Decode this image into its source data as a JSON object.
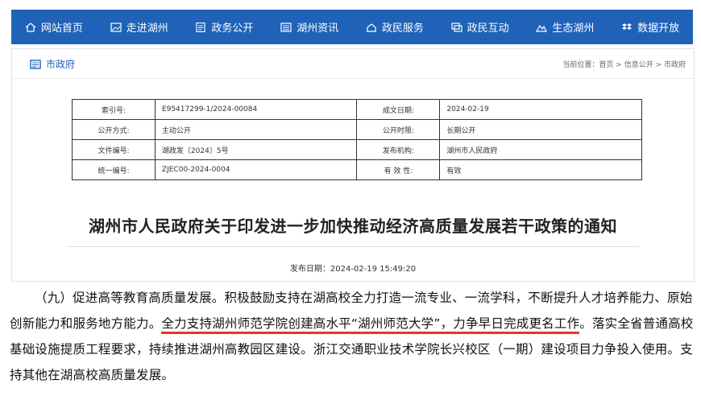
{
  "nav": [
    {
      "label": "网站首页",
      "icon": "home-icon"
    },
    {
      "label": "走进湖州",
      "icon": "picture-icon"
    },
    {
      "label": "政务公开",
      "icon": "document-icon"
    },
    {
      "label": "湖州资讯",
      "icon": "news-icon"
    },
    {
      "label": "政民服务",
      "icon": "service-icon"
    },
    {
      "label": "政民互动",
      "icon": "chat-icon"
    },
    {
      "label": "生态湖州",
      "icon": "mountain-icon"
    },
    {
      "label": "数据开放",
      "icon": "dropbox-icon"
    }
  ],
  "section": {
    "label": "市政府",
    "icon": "newspaper-icon"
  },
  "breadcrumb": {
    "prefix": "当前位置：",
    "items": [
      "首页",
      "信息公开",
      "市政府"
    ],
    "separator": " > "
  },
  "info": {
    "rows": [
      [
        {
          "k": "索引号:",
          "v": "E95417299-1/2024-00084"
        },
        {
          "k": "成文日期:",
          "v": "2024-02-19"
        }
      ],
      [
        {
          "k": "公开方式:",
          "v": "主动公开"
        },
        {
          "k": "公开时限:",
          "v": "长期公开"
        }
      ],
      [
        {
          "k": "文件编号:",
          "v": "湖政发〔2024〕5号"
        },
        {
          "k": "发布机构:",
          "v": "湖州市人民政府"
        }
      ],
      [
        {
          "k": "统一编号:",
          "v": "ZJEC00-2024-0004"
        },
        {
          "k": "有 效 性:",
          "v": "有效"
        }
      ]
    ]
  },
  "doc": {
    "title": "湖州市人民政府关于印发进一步加快推动经济高质量发展若干政策的通知",
    "pub_label": "发布日期：",
    "pub_date": "2024-02-19 15:49:20"
  },
  "article": {
    "p1": "（九）促进高等教育高质量发展。积极鼓励支持在湖高校全力打造一流专业、一流学科，不断提升人才培养能力、原始创新能力和服务地方能力。",
    "highlight": "全力支持湖州师范学院创建高水平“湖州师范大学”，力争早日完成更名工作",
    "p2": "。落实全省普通高校基础设施提质工程要求，持续推进湖州高教园区建设。浙江交通职业技术学院长兴校区（一期）建设项目力争投入使用。支持其他在湖高校高质量发展。"
  },
  "colors": {
    "nav": "#1f62b8",
    "highlight": "#e8332e"
  }
}
